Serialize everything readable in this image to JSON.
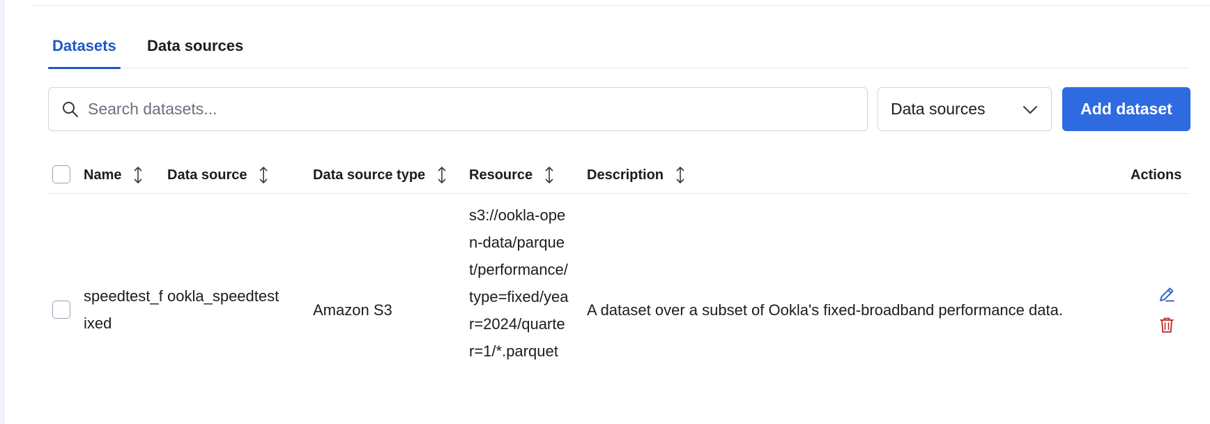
{
  "tabs": [
    {
      "label": "Datasets",
      "active": true
    },
    {
      "label": "Data sources",
      "active": false
    }
  ],
  "search": {
    "placeholder": "Search datasets...",
    "value": ""
  },
  "filter": {
    "selected": "Data sources",
    "icon": "chevron-down-icon"
  },
  "add_button": {
    "label": "Add dataset"
  },
  "table": {
    "columns": [
      "Name",
      "Data source",
      "Data source type",
      "Resource",
      "Description",
      "Actions"
    ],
    "rows": [
      {
        "name": "speedtest_fixed",
        "data_source": "ookla_speedtest",
        "data_source_type": "Amazon S3",
        "resource": "s3://ookla-open-data/parquet/performance/type=fixed/year=2024/quarter=1/*.parquet",
        "description": "A dataset over a subset of Ookla's fixed-broadband performance data.",
        "actions": [
          "pencil-icon",
          "trash-icon"
        ]
      }
    ]
  },
  "colors": {
    "accent": "#1e57c8",
    "button": "#2e6be0",
    "danger": "#bd271e"
  }
}
